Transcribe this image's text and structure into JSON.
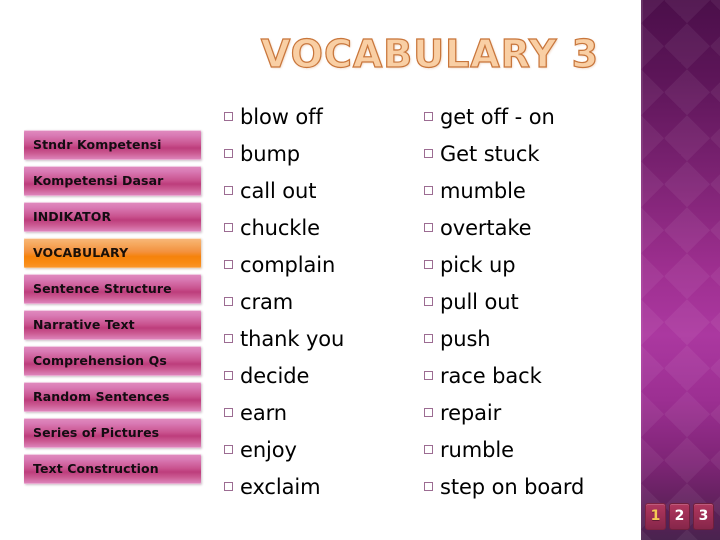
{
  "slide": {
    "title": "VOCABULARY 3",
    "background_color": "#ffffff",
    "accent_color": "#f5820b",
    "panel_color": "#9e2f90",
    "title_color": "#f9c79a"
  },
  "sidebar": {
    "items": [
      {
        "label": "Stndr Kompetensi",
        "active": false
      },
      {
        "label": "Kompetensi Dasar",
        "active": false
      },
      {
        "label": "INDIKATOR",
        "active": false
      },
      {
        "label": "VOCABULARY",
        "active": true
      },
      {
        "label": "Sentence Structure",
        "active": false
      },
      {
        "label": "Narrative Text",
        "active": false
      },
      {
        "label": "Comprehension Qs",
        "active": false
      },
      {
        "label": "Random Sentences",
        "active": false
      },
      {
        "label": "Series of Pictures",
        "active": false
      },
      {
        "label": "Text Construction",
        "active": false
      }
    ]
  },
  "content": {
    "bullet_icon": "hollow-square-bullet",
    "columns": [
      {
        "items": [
          "blow off",
          "bump",
          "call out",
          "chuckle",
          "complain",
          "cram",
          "thank you",
          "decide",
          "earn",
          "enjoy",
          "exclaim"
        ]
      },
      {
        "items": [
          "get off - on",
          "Get stuck",
          "mumble",
          "overtake",
          "pick up",
          "pull out",
          "push",
          "race back",
          "repair",
          "rumble",
          "step on board"
        ]
      }
    ]
  },
  "pagination": {
    "pages": [
      "1",
      "2",
      "3"
    ],
    "current": "1",
    "current_color": "#f5cb55"
  }
}
